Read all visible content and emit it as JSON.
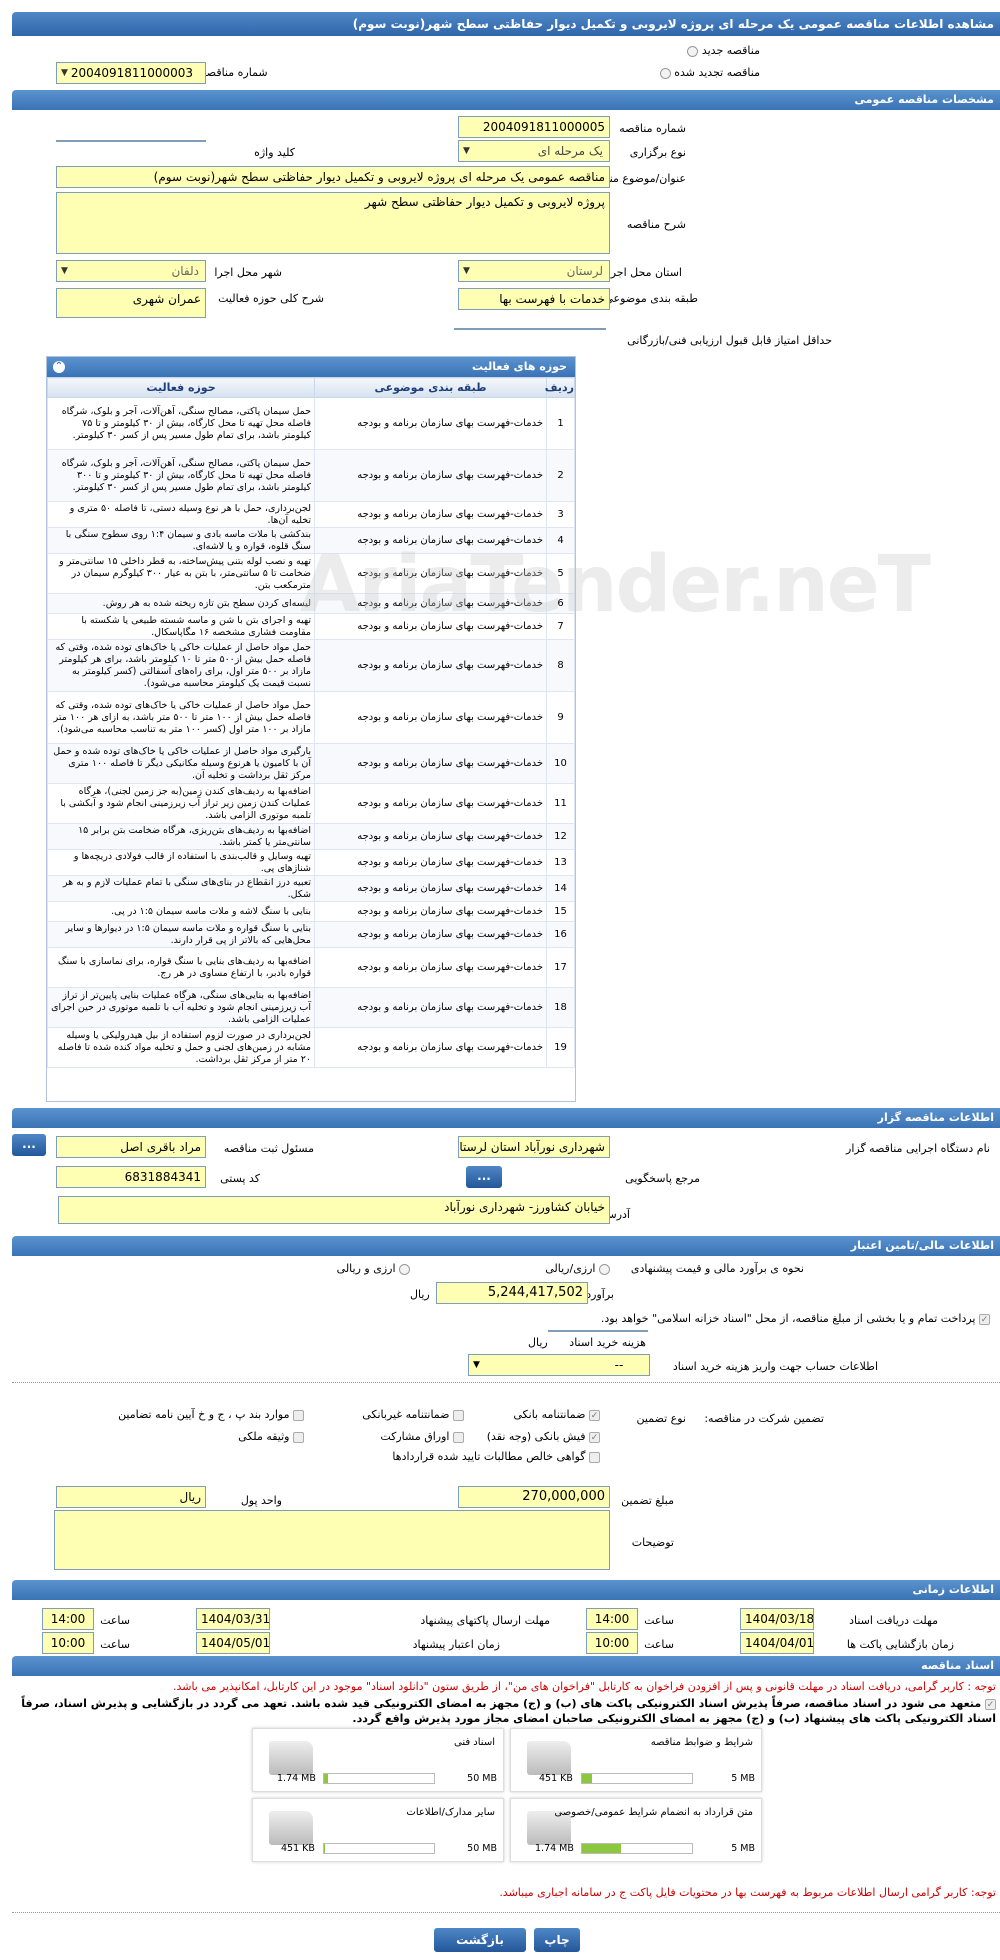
{
  "title": "مشاهده اطلاعات مناقصه عمومی یک مرحله ای پروژه لایروبی و تکمیل دیوار حفاظتی سطح شهر(نوبت سوم)",
  "top": {
    "new_tender": "مناقصه جدید",
    "renewed_tender": "مناقصه تجدید شده",
    "prev_number_label": "شماره مناقصه قبلی",
    "prev_number": "2004091811000003"
  },
  "general": {
    "header": "مشخصات مناقصه عمومی",
    "number_label": "شماره مناقصه",
    "number": "2004091811000005",
    "type_label": "نوع برگزاری",
    "type": "یک مرحله ای",
    "keyword_label": "کلید واژه",
    "keyword": "",
    "subject_label": "عنوان/موضوع مناقصه",
    "subject": "مناقصه عمومی یک مرحله ای پروژه لایروبی و تکمیل دیوار حفاظتی سطح شهر(نوبت سوم)",
    "desc_label": "شرح مناقصه",
    "desc": "پروژه لایروبی و تکمیل دیوار حفاظتی سطح شهر",
    "province_label": "استان محل اجرا",
    "province": "لرستان",
    "city_label": "شهر محل اجرا",
    "city": "دلفان",
    "category_label": "طبقه بندی موضوعی",
    "category": "خدمات با فهرست بها",
    "activity_label": "شرح کلی حوزه فعالیت",
    "activity": "عمران شهری",
    "min_score_label": "حداقل امتیاز قابل قبول ارزیابی فنی/بازرگانی",
    "min_score": ""
  },
  "activities": {
    "header": "حوزه های فعالیت",
    "col_row": "ردیف",
    "col_category": "طبقه بندی موضوعی",
    "col_scope": "حوزه فعالیت",
    "rows": [
      {
        "n": "1",
        "cat": "خدمات-فهرست بهای سازمان برنامه و بودجه",
        "scope": "حمل سیمان پاکتی، مصالح سنگی، آهن‌آلات، آجر و بلوک، شرگاه فاصله محل تهیه تا محل کارگاه، بیش از ۳۰ کیلومتر و تا ۷۵ کیلومتر باشد، برای تمام طول مسیر پس از کسر ۳۰ کیلومتر."
      },
      {
        "n": "2",
        "cat": "خدمات-فهرست بهای سازمان برنامه و بودجه",
        "scope": "حمل سیمان پاکتی، مصالح سنگی، آهن‌آلات، آجر و بلوک، شرگاه فاصله محل تهیه تا محل کارگاه، بیش از ۳۰ کیلومتر و تا ۳۰۰ کیلومتر باشد، برای تمام طول مسیر پس از کسر ۳۰ کیلومتر."
      },
      {
        "n": "3",
        "cat": "خدمات-فهرست بهای سازمان برنامه و بودجه",
        "scope": "لجن‌برداری، حمل با هر نوع وسیله دستی، تا فاصله ۵۰ متری و تخلیه آن‌ها."
      },
      {
        "n": "4",
        "cat": "خدمات-فهرست بهای سازمان برنامه و بودجه",
        "scope": "بندکشی با ملات ماسه بادی و سیمان ۱:۴ روی سطوح سنگی با سنگ قلوه، قواره و یا لاشه‌ای."
      },
      {
        "n": "5",
        "cat": "خدمات-فهرست بهای سازمان برنامه و بودجه",
        "scope": "تهیه و نصب لوله بتنی پیش‌ساخته، به قطر داخلی ۱۵ سانتی‌متر و ضخامت تا ۵ سانتی‌متر، با بتن به عیار ۳۰۰ کیلوگرم سیمان در مترمکعب بتن."
      },
      {
        "n": "6",
        "cat": "خدمات-فهرست بهای سازمان برنامه و بودجه",
        "scope": "لیسه‌ای کردن سطح بتن تازه ریخته شده به هر روش."
      },
      {
        "n": "7",
        "cat": "خدمات-فهرست بهای سازمان برنامه و بودجه",
        "scope": "تهیه و اجرای بتن با شن و ماسه شسته طبیعی یا شکسته با مقاومت فشاری مشخصه ۱۶ مگاپاسکال."
      },
      {
        "n": "8",
        "cat": "خدمات-فهرست بهای سازمان برنامه و بودجه",
        "scope": "حمل مواد حاصل از عملیات خاکی یا خاک‌های توده شده، وقتی که فاصله حمل بیش از۵۰۰ متر تا ۱۰ کیلومتر باشد، برای هر کیلومتر مازاد بر ۵۰۰ متر اول، برای راه‌های آسفالتی (کسر کیلومتر به نسبت قیمت یک کیلومتر محاسبه می‌شود)."
      },
      {
        "n": "9",
        "cat": "خدمات-فهرست بهای سازمان برنامه و بودجه",
        "scope": "حمل مواد حاصل از عملیات خاکی یا خاک‌های توده شده، وقتی که فاصله حمل بیش از ۱۰۰ متر تا ۵۰۰ متر باشد، به ازای هر ۱۰۰ متر مازاد بر ۱۰۰ متر اول (کسر ۱۰۰ متر به تناسب محاسبه می‌شود)."
      },
      {
        "n": "10",
        "cat": "خدمات-فهرست بهای سازمان برنامه و بودجه",
        "scope": "بارگیری مواد حاصل از عملیات خاکی یا خاک‌های توده شده و حمل آن با کامیون یا هرنوع وسیله مکانیکی دیگر تا فاصله ۱۰۰ متری مرکز ثقل برداشت و تخلیه آن."
      },
      {
        "n": "11",
        "cat": "خدمات-فهرست بهای سازمان برنامه و بودجه",
        "scope": "اضافه‌بها به ردیف‌های کندن زمین(به جز زمین لجنی)، هرگاه عملیات کندن زمین زیر تراز آب زیرزمینی انجام شود و آبکشی با تلمبه موتوری الزامی باشد."
      },
      {
        "n": "12",
        "cat": "خدمات-فهرست بهای سازمان برنامه و بودجه",
        "scope": "اضافه‌بها به ردیف‌های بتن‌ریزی، هرگاه ضخامت بتن برابر ۱۵ سانتی‌متر یا کمتر باشد."
      },
      {
        "n": "13",
        "cat": "خدمات-فهرست بهای سازمان برنامه و بودجه",
        "scope": "تهیه وسایل و قالب‌بندی با استفاده از قالب فولادی دریچه‌ها و شناژهای پی."
      },
      {
        "n": "14",
        "cat": "خدمات-فهرست بهای سازمان برنامه و بودجه",
        "scope": "تعبیه درز انقطاع در بنای‌های سنگی با تمام عملیات لازم و به هر شکل."
      },
      {
        "n": "15",
        "cat": "خدمات-فهرست بهای سازمان برنامه و بودجه",
        "scope": "بنایی با سنگ لاشه و ملات ماسه سیمان ۱:۵ در پی."
      },
      {
        "n": "16",
        "cat": "خدمات-فهرست بهای سازمان برنامه و بودجه",
        "scope": "بنایی با سنگ قواره و ملات ماسه سیمان ۱:۵ در دیوارها و سایر محل‌هایی که بالاتر از پی قرار دارند."
      },
      {
        "n": "17",
        "cat": "خدمات-فهرست بهای سازمان برنامه و بودجه",
        "scope": "اضافه‌بها به ردیف‌های بنایی با سنگ قواره، برای نماسازی با سنگ قواره بادبر، با ارتفاع مساوی در هر رج."
      },
      {
        "n": "18",
        "cat": "خدمات-فهرست بهای سازمان برنامه و بودجه",
        "scope": "اضافه‌بها به بنایی‌های سنگی، هرگاه عملیات بنایی پایین‌تر از تراز آب زیرزمینی انجام شود و تخلیه آب با تلمبه موتوری در حین اجرای عملیات الزامی باشد."
      },
      {
        "n": "19",
        "cat": "خدمات-فهرست بهای سازمان برنامه و بودجه",
        "scope": "لجن‌برداری در صورت لزوم استفاده از بیل هیدرولیکی یا وسیله مشابه در زمین‌های لجنی و حمل و تخلیه مواد کنده شده تا فاصله ۲۰ متر از مرکز ثقل برداشت."
      }
    ]
  },
  "organizer": {
    "header": "اطلاعات مناقصه گزار",
    "org_label": "نام دستگاه اجرایی مناقصه گزار",
    "org": "شهرداری نورآباد استان لرستان",
    "official_label": "مسئول ثبت مناقصه",
    "official": "مراد باقری اصل",
    "ref_label": "مرجع پاسخگویی",
    "postal_label": "کد پستی",
    "postal": "6831884341",
    "address_label": "آدرس",
    "address": "خیابان کشاورز- شهرداری نورآباد",
    "dots": "..."
  },
  "financial": {
    "header": "اطلاعات مالی/تامین اعتبار",
    "estimate_label": "نحوه ی برآورد مالی و قیمت پیشنهادی",
    "opt_rial": "ارزی/ریالی",
    "opt_fx": "ارزی و ریالی",
    "estimate_amount_label": "برآورد مالی",
    "estimate_amount": "5,244,417,502",
    "currency": "ریال",
    "payment_note": "پرداخت تمام و یا بخشی از مبلغ مناقصه، از محل \"اسناد خزانه اسلامی\" خواهد بود.",
    "doc_fee_label": "هزینه خرید اسناد",
    "doc_fee": "",
    "account_label": "اطلاعات حساب جهت واریز هزینه خرید اسناد",
    "account": "--"
  },
  "guarantee": {
    "section_label": "تضمین شرکت در مناقصه:",
    "type_label": "نوع تضمین",
    "opts": [
      "ضمانتنامه بانکی",
      "ضمانتنامه غیربانکی",
      "موارد بند پ ، ج و خ آیین نامه تضامین",
      "فیش بانکی (وجه نقد)",
      "اوراق مشارکت",
      "وثیقه ملکی",
      "گواهی خالص مطالبات تایید شده قراردادها"
    ],
    "amount_label": "مبلغ تضمین",
    "amount": "270,000,000",
    "unit_label": "واحد پول",
    "unit": "ریال",
    "notes_label": "توضیحات",
    "notes": ""
  },
  "schedule": {
    "header": "اطلاعات زمانی",
    "receive_deadline_label": "مهلت دریافت اسناد",
    "receive_deadline": "1404/03/18",
    "submit_deadline_label": "مهلت ارسال پاکتهای پیشنهاد",
    "submit_deadline": "1404/03/31",
    "opening_label": "زمان بازگشایی پاکت ها",
    "opening": "1404/04/01",
    "validity_label": "زمان اعتبار پیشنهاد",
    "validity": "1404/05/01",
    "time_label": "ساعت",
    "t1": "14:00",
    "t2": "14:00",
    "t3": "10:00",
    "t4": "10:00"
  },
  "docs": {
    "header": "اسناد مناقصه",
    "note1": "توجه : کاربر گرامی، دریافت اسناد در مهلت قانونی و پس از افزودن فراخوان به کارتابل \"فراخوان های من\"، از طریق ستون \"دانلود اسناد\" موجود در این کارتابل، امکانپذیر می باشد.",
    "note2": "متعهد می شود در اسناد مناقصه، صرفاً پذیرش اسناد الکترونیکی پاکت های (ب) و (ج) مجهز به امضای الکترونیکی قید شده باشد. تعهد می گردد در بازگشایی و پذیرش اسناد، صرفاً اسناد الکترونیکی پاکت های پیشنهاد (ب) و (ج) مجهز به امضای الکترونیکی صاحبان امضای مجاز مورد پذیرش واقع گردد.",
    "files": [
      {
        "name": "شرایط و ضوابط مناقصه",
        "max": "5 MB",
        "size": "451 KB",
        "fill": 0.09
      },
      {
        "name": "اسناد فنی",
        "max": "50 MB",
        "size": "1.74 MB",
        "fill": 0.035
      },
      {
        "name": "متن قرارداد به انضمام شرایط عمومی/خصوصی",
        "max": "5 MB",
        "size": "1.74 MB",
        "fill": 0.35
      },
      {
        "name": "سایر مدارک/اطلاعات",
        "max": "50 MB",
        "size": "451 KB",
        "fill": 0.01
      }
    ],
    "note3": "توجه: کاربر گرامی ارسال اطلاعات مربوط به فهرست بها در محتویات فایل پاکت ج در سامانه اجباری میباشد."
  },
  "buttons": {
    "print": "چاپ",
    "back": "بازگشت"
  },
  "watermark": "AriaTender.neT",
  "colors": {
    "accent": "#3a73b5",
    "field_bg": "#ffffb3",
    "note_red": "#cc0000"
  }
}
